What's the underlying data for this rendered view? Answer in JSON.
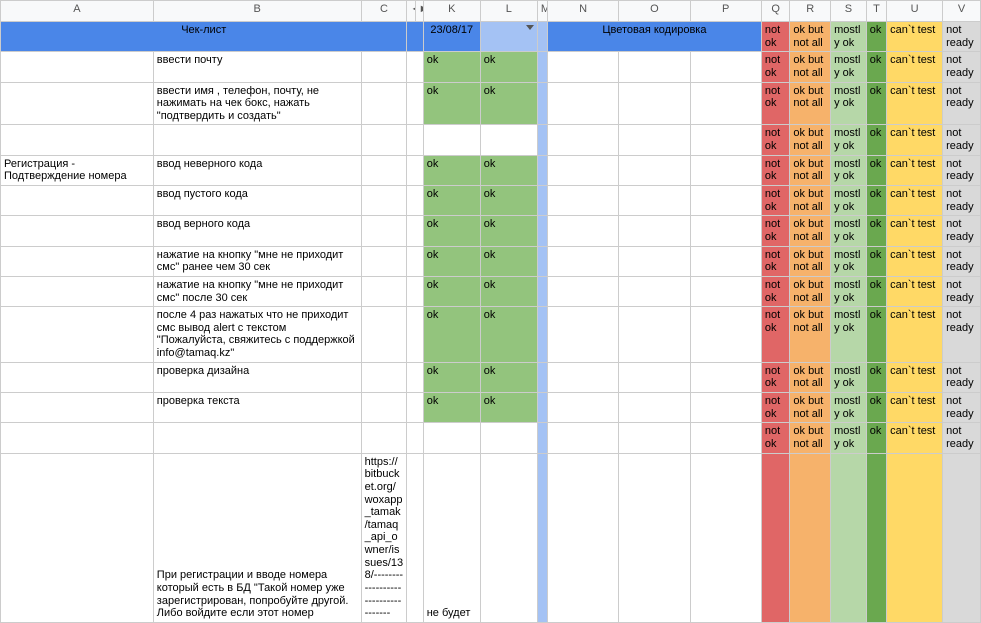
{
  "columns": {
    "A": "A",
    "B": "B",
    "C": "C",
    "arrowL": "◄",
    "arrowR": "►",
    "K": "K",
    "L": "L",
    "M": "M",
    "N": "N",
    "O": "O",
    "P": "P",
    "Q": "Q",
    "R": "R",
    "S": "S",
    "T": "T",
    "U": "U",
    "V": "V"
  },
  "header": {
    "checklist": "Чек-лист",
    "date": "23/08/17",
    "colorCoding": "Цветовая кодировка"
  },
  "legend": {
    "notok": "not ok",
    "okbut": "ok but not all",
    "mostly": "mostly ok",
    "ok": "ok",
    "cant": "can`t test",
    "notready": "not ready"
  },
  "status": {
    "ok": "ok"
  },
  "sectionA": "Регистрация - Подтверждение номера",
  "rows": [
    {
      "b": "ввести почту",
      "k": "ok",
      "l": "ok"
    },
    {
      "b": "ввести имя , телефон, почту, не нажимать на чек бокс, нажать \"подтвердить и создать\"",
      "k": "ok",
      "l": "ok"
    },
    {
      "b": "",
      "k": "",
      "l": ""
    },
    {
      "b": "ввод неверного кода",
      "k": "ok",
      "l": "ok"
    },
    {
      "b": "ввод пустого кода",
      "k": "ok",
      "l": "ok"
    },
    {
      "b": "ввод верного кода",
      "k": "ok",
      "l": "ok"
    },
    {
      "b": "нажатие на кнопку \"мне не приходит смс\" ранее чем 30 сек",
      "k": "ok",
      "l": "ok"
    },
    {
      "b": "нажатие на кнопку \"мне не приходит смс\" после 30 сек",
      "k": "ok",
      "l": "ok"
    },
    {
      "b": "после 4 раз нажатых что не приходит смс вывод alert c текстом \"Пожалуйста, свяжитесь с поддержкой info@tamaq.kz\"",
      "k": "ok",
      "l": "ok"
    },
    {
      "b": "проверка дизайна",
      "k": "ok",
      "l": "ok"
    },
    {
      "b": "проверка текста",
      "k": "ok",
      "l": "ok"
    },
    {
      "b": "",
      "k": "",
      "l": ""
    }
  ],
  "foot": {
    "c": "https://bitbucket.org/woxapp_tamak/tamaq_api_owner/issues/138/-----------------------------------",
    "b": "При регистрации и вводе номера который есть в БД  \"Такой номер уже зарегистрирован, попробуйте другой. Либо войдите если этот номер",
    "k": "не будет"
  }
}
